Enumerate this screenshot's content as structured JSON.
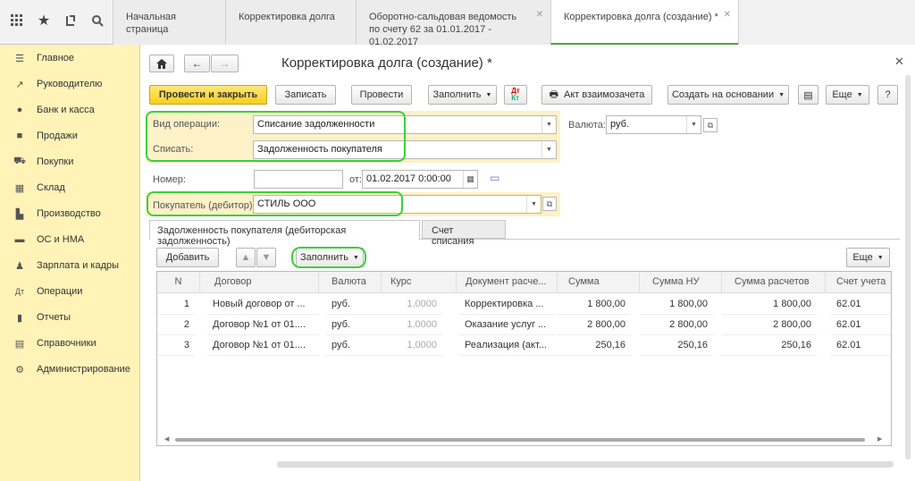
{
  "tabs": [
    {
      "label": "Начальная страница"
    },
    {
      "label": "Корректировка долга"
    },
    {
      "label": "Оборотно-сальдовая ведомость по счету 62 за 01.01.2017 - 01.02.2017"
    },
    {
      "label": "Корректировка долга (создание) *"
    }
  ],
  "sidebar": {
    "items": [
      {
        "label": "Главное",
        "icon": "menu-icon"
      },
      {
        "label": "Руководителю",
        "icon": "trend-icon"
      },
      {
        "label": "Банк и касса",
        "icon": "coin-icon"
      },
      {
        "label": "Продажи",
        "icon": "bag-icon"
      },
      {
        "label": "Покупки",
        "icon": "cart-icon"
      },
      {
        "label": "Склад",
        "icon": "warehouse-icon"
      },
      {
        "label": "Производство",
        "icon": "factory-icon"
      },
      {
        "label": "ОС и НМА",
        "icon": "truck-icon"
      },
      {
        "label": "Зарплата и кадры",
        "icon": "person-icon"
      },
      {
        "label": "Операции",
        "icon": "dt-kt-icon"
      },
      {
        "label": "Отчеты",
        "icon": "chart-icon"
      },
      {
        "label": "Справочники",
        "icon": "book-icon"
      },
      {
        "label": "Администрирование",
        "icon": "gear-icon"
      }
    ]
  },
  "form": {
    "title": "Корректировка долга (создание) *",
    "toolbar": {
      "post_close": "Провести и закрыть",
      "save": "Записать",
      "post": "Провести",
      "fill": "Заполнить",
      "act": "Акт взаимозачета",
      "create_based": "Создать на основании",
      "more": "Еще",
      "help": "?"
    },
    "fields": {
      "operation_label": "Вид операции:",
      "operation_value": "Списание задолженности",
      "writeoff_label": "Списать:",
      "writeoff_value": "Задолженность покупателя",
      "currency_label": "Валюта:",
      "currency_value": "руб.",
      "number_label": "Номер:",
      "number_value": "",
      "date_label": "от:",
      "date_value": "01.02.2017  0:00:00",
      "buyer_label": "Покупатель (дебитор):",
      "buyer_value": "СТИЛЬ ООО"
    },
    "subtabs": [
      {
        "label": "Задолженность покупателя (дебиторская задолженность)"
      },
      {
        "label": "Счет списания"
      }
    ],
    "table_toolbar": {
      "add": "Добавить",
      "fill": "Заполнить",
      "more": "Еще"
    },
    "columns": [
      "N",
      "Договор",
      "Валюта",
      "Курс",
      "Документ расче...",
      "Сумма",
      "Сумма НУ",
      "Сумма расчетов",
      "Счет учета"
    ],
    "rows": [
      [
        "1",
        "Новый договор от ...",
        "руб.",
        "1,0000",
        "Корректировка ...",
        "1 800,00",
        "1 800,00",
        "1 800,00",
        "62.01"
      ],
      [
        "2",
        "Договор №1 от 01....",
        "руб.",
        "1,0000",
        "Оказание услуг ...",
        "2 800,00",
        "2 800,00",
        "2 800,00",
        "62.01"
      ],
      [
        "3",
        "Договор №1 от 01....",
        "руб.",
        "1,0000",
        "Реализация (акт...",
        "250,16",
        "250,16",
        "250,16",
        "62.01"
      ]
    ]
  },
  "colors": {
    "accent_yellow": "#f7cf1e",
    "highlight_green": "#3bd03b",
    "sidebar": "#fff3b8"
  }
}
